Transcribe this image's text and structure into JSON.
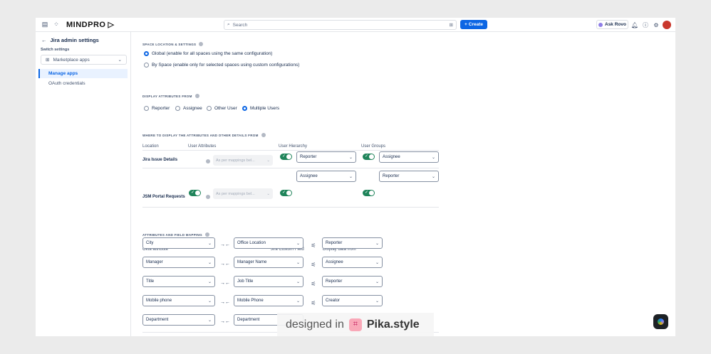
{
  "topbar": {
    "logo": "MINDPRO",
    "search_placeholder": "Search",
    "create_label": "Create",
    "rovo_label": "Ask Rovo"
  },
  "sidebar": {
    "title": "Jira admin settings",
    "switch_label": "Switch settings",
    "select_value": "Marketplace apps",
    "items": [
      {
        "label": "Manage apps",
        "active": true
      },
      {
        "label": "OAuth credentials",
        "active": false
      }
    ]
  },
  "space_location": {
    "title": "SPACE LOCATION & SETTINGS",
    "options": [
      {
        "label": "Global (enable for all spaces using the same configuration)",
        "selected": true
      },
      {
        "label": "By Space (enable only for selected spaces using custom configurations)",
        "selected": false
      }
    ]
  },
  "display_from": {
    "title": "DISPLAY ATTRIBUTES FROM",
    "options": [
      {
        "label": "Reporter",
        "selected": false
      },
      {
        "label": "Assignee",
        "selected": false
      },
      {
        "label": "Other User",
        "selected": false
      },
      {
        "label": "Multiple Users",
        "selected": true
      }
    ]
  },
  "where_display": {
    "title": "WHERE TO DISPLAY THE ATTRIBUTES AND OTHER DETAILS FROM",
    "headers": [
      "Location",
      "User Attributes",
      "User Hierarchy",
      "User Groups"
    ],
    "rows": [
      {
        "location": "Jira Issue Details",
        "attr_toggle": false,
        "attr_placeholder": "As per mappings bel...",
        "hierarchy_value": "Reporter",
        "groups_value": "Assignee"
      },
      {
        "location": "JSM Portal Requests",
        "attr_toggle": true,
        "attr_placeholder": "As per mappings bel...",
        "hierarchy_value": "Assignee",
        "groups_value": "Reporter"
      }
    ]
  },
  "field_mapping": {
    "title": "ATTRIBUTES AND FIELD MAPPING",
    "headers": [
      "Okta attribute",
      "Jira Custom Field",
      "Display data from"
    ],
    "rows": [
      {
        "okta": "City",
        "jira": "Office Location",
        "display": "Reporter"
      },
      {
        "okta": "Manager",
        "jira": "Manager Name",
        "display": "Assignee"
      },
      {
        "okta": "Title",
        "jira": "Job Title",
        "display": "Reporter"
      },
      {
        "okta": "Mobile phone",
        "jira": "Mobile Phone",
        "display": "Creator"
      },
      {
        "okta": "Department",
        "jira": "Department",
        "display": ""
      }
    ]
  },
  "watermark": {
    "prefix": "designed in",
    "brand": "Pika.style"
  },
  "colors": {
    "accent": "#0c66e4",
    "toggle_on": "#1f845a"
  }
}
